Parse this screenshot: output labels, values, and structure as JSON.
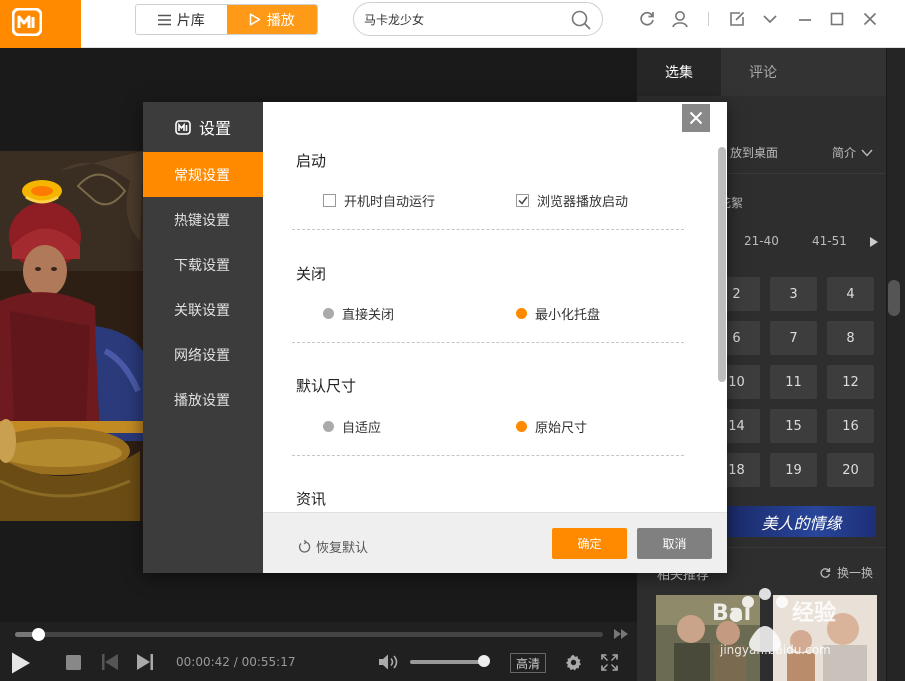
{
  "nav": {
    "library_label": "片库",
    "play_label": "播放"
  },
  "search": {
    "value": "马卡龙少女"
  },
  "right_panel": {
    "tabs": [
      "选集",
      "评论"
    ],
    "desktop_label": "放到桌面",
    "intro_label": "简介",
    "section_fragment": "花絮",
    "ranges": [
      "21-40",
      "41-51"
    ],
    "episodes": [
      "2",
      "3",
      "4",
      "6",
      "7",
      "8",
      "10",
      "11",
      "12",
      "14",
      "15",
      "16",
      "18",
      "19",
      "20"
    ],
    "banner_text": "美人的情缘",
    "related_label": "相关推荐",
    "refresh_label": "换一换"
  },
  "player": {
    "current_time": "00:00:42",
    "time_sep": " / ",
    "duration": "00:55:17",
    "quality": "高清",
    "progress_fraction": 0.04,
    "volume_fraction": 0.97
  },
  "dialog": {
    "title": "设置",
    "nav": [
      "常规设置",
      "热键设置",
      "下载设置",
      "关联设置",
      "网络设置",
      "播放设置"
    ],
    "sections": {
      "startup": {
        "title": "启动",
        "auto_run": "开机时自动运行",
        "browser_launch": "浏览器播放启动"
      },
      "close": {
        "title": "关闭",
        "direct": "直接关闭",
        "minimize": "最小化托盘"
      },
      "size": {
        "title": "默认尺寸",
        "adaptive": "自适应",
        "original": "原始尺寸"
      },
      "news": {
        "title": "资讯"
      }
    },
    "restore_label": "恢复默认",
    "ok_label": "确定",
    "cancel_label": "取消"
  },
  "watermark": {
    "text1": "Bai",
    "text2": "经验",
    "url": "jingyan.baidu.com"
  },
  "colors": {
    "accent": "#ff8a00",
    "dialog_sidebar": "#3c3c3c",
    "panel": "#2e2e2e"
  }
}
